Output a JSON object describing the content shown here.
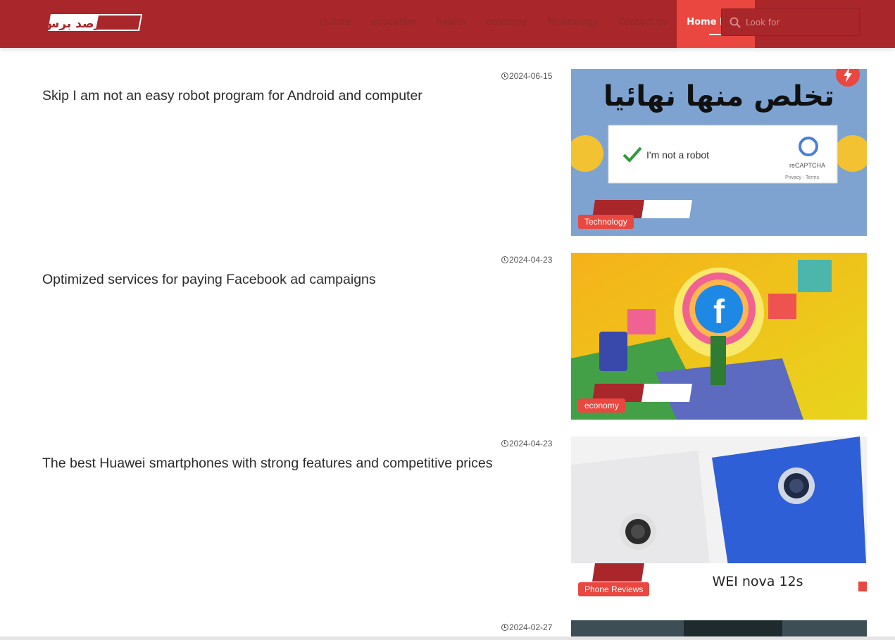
{
  "header": {
    "logo_text": "رصد برس",
    "nav": [
      {
        "label": "culture"
      },
      {
        "label": "education"
      },
      {
        "label": "health"
      },
      {
        "label": "economy"
      },
      {
        "label": "Technology"
      },
      {
        "label": "Contact us"
      },
      {
        "label": "Home Page"
      }
    ],
    "search_placeholder": "Look for"
  },
  "articles": [
    {
      "date": "2024-06-15",
      "title": "Skip I am not an easy robot program for Android and computer",
      "category": "Technology",
      "image_text": "تخلص منها نهائيا",
      "captcha_label": "I'm not a robot",
      "captcha_brand": "reCAPTCHA",
      "captcha_links": "Privacy - Terms"
    },
    {
      "date": "2024-04-23",
      "title": "Optimized services for paying Facebook ad campaigns",
      "category": "economy"
    },
    {
      "date": "2024-04-23",
      "title": "The best Huawei smartphones with strong features and competitive prices",
      "category": "Phone Reviews",
      "image_text": "WEI nova 12s"
    },
    {
      "date": "2024-02-27",
      "title": "",
      "category": ""
    }
  ],
  "colors": {
    "header_bg": "#a9262b",
    "accent": "#e9473f"
  }
}
